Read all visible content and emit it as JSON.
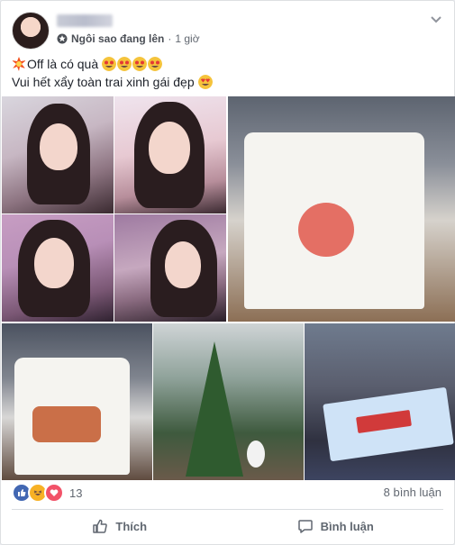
{
  "post": {
    "status": "Ngôi sao đang lên",
    "separator": "·",
    "time": "1 giờ",
    "line1_text": "Off là có quà",
    "line2_text": "Vui hết xẩy toàn trai xinh gái đẹp"
  },
  "engagement": {
    "reaction_count": "13",
    "comments": "8 bình luận"
  },
  "actions": {
    "like": "Thích",
    "comment": "Bình luận"
  },
  "colors": {
    "like_blue": "#4267b2",
    "haha_yellow": "#f7b125",
    "love_red": "#f25268",
    "emoji_star_eyes": "#f5c33b"
  },
  "icons": {
    "more": "chevron-down-icon",
    "status": "star-icon",
    "boom": "collision-emoji",
    "like": "thumbs-up-icon",
    "comment": "speech-bubble-icon"
  }
}
